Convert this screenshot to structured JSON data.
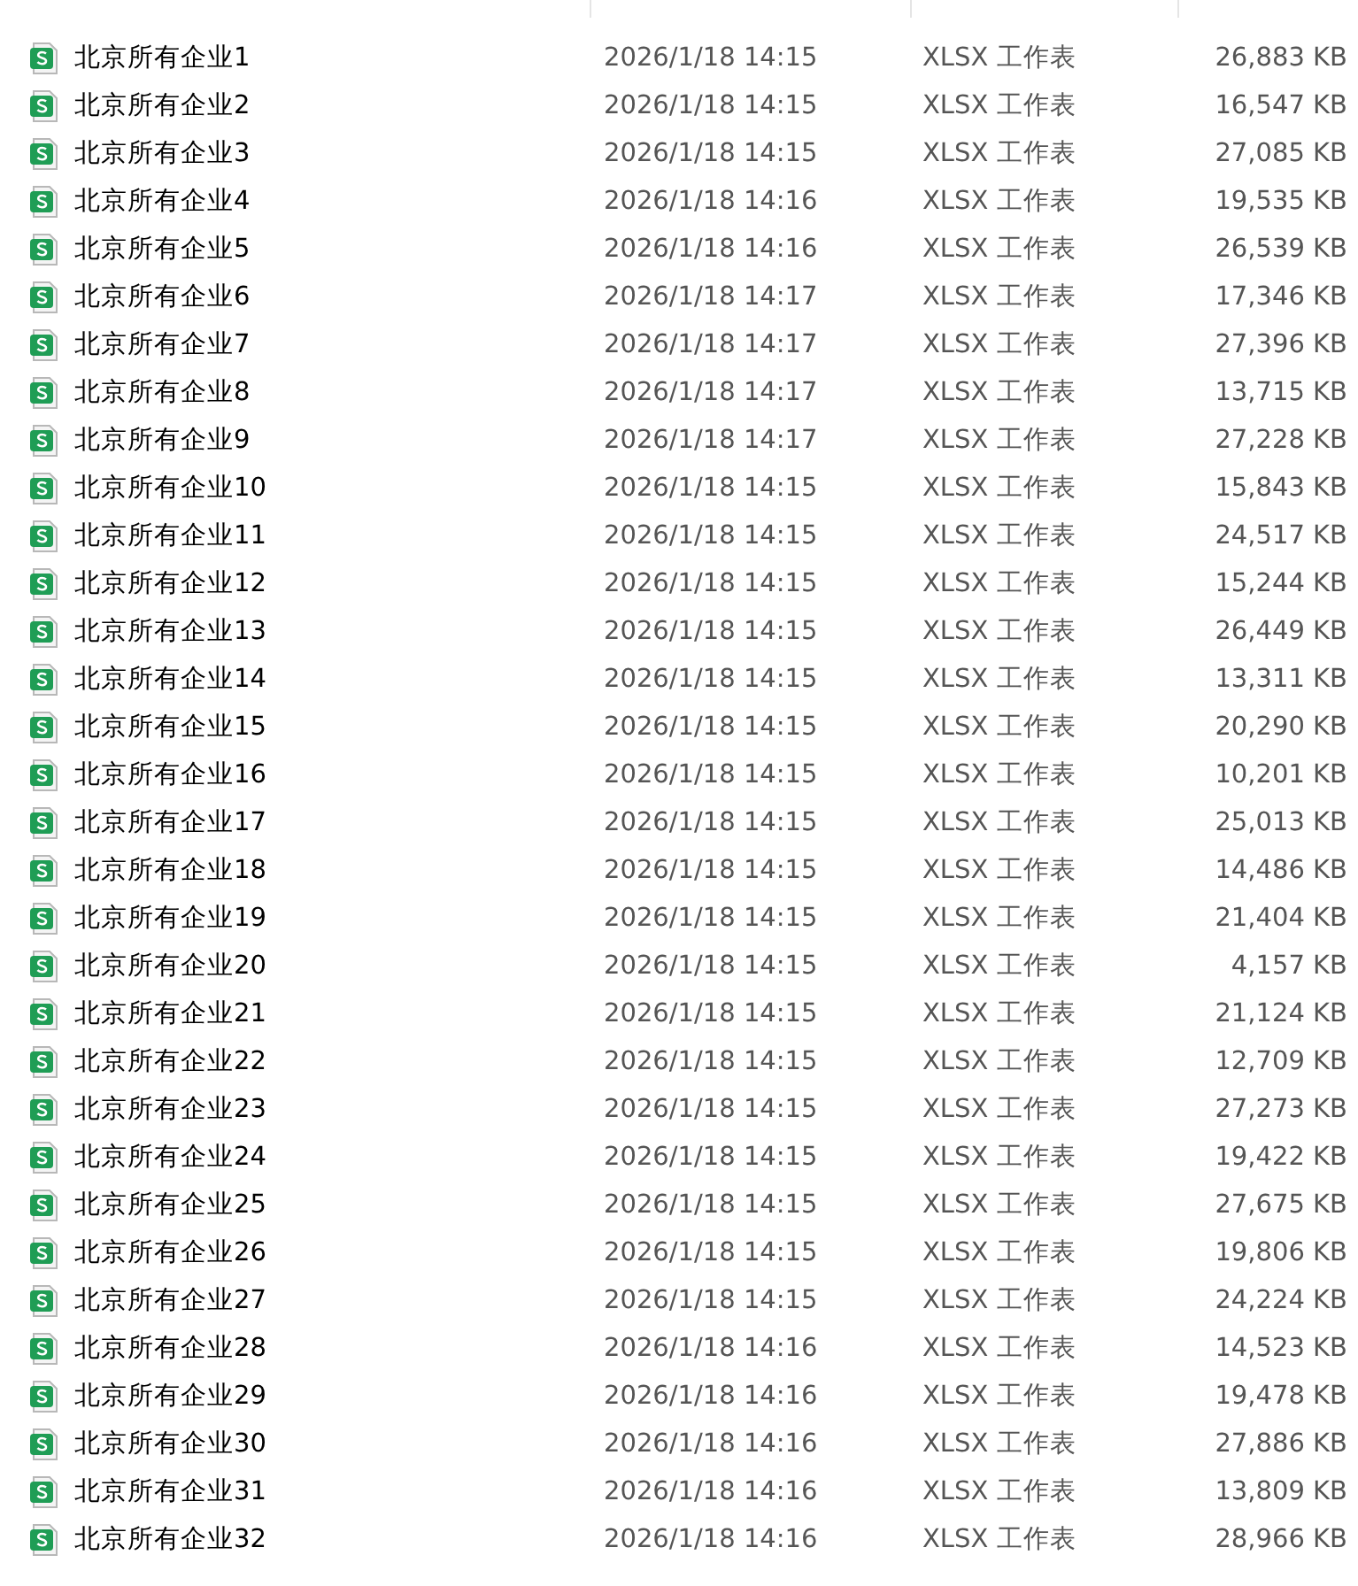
{
  "files": [
    {
      "name": "北京所有企业1",
      "modified": "2026/1/18 14:15",
      "type": "XLSX 工作表",
      "size": "26,883 KB"
    },
    {
      "name": "北京所有企业2",
      "modified": "2026/1/18 14:15",
      "type": "XLSX 工作表",
      "size": "16,547 KB"
    },
    {
      "name": "北京所有企业3",
      "modified": "2026/1/18 14:15",
      "type": "XLSX 工作表",
      "size": "27,085 KB"
    },
    {
      "name": "北京所有企业4",
      "modified": "2026/1/18 14:16",
      "type": "XLSX 工作表",
      "size": "19,535 KB"
    },
    {
      "name": "北京所有企业5",
      "modified": "2026/1/18 14:16",
      "type": "XLSX 工作表",
      "size": "26,539 KB"
    },
    {
      "name": "北京所有企业6",
      "modified": "2026/1/18 14:17",
      "type": "XLSX 工作表",
      "size": "17,346 KB"
    },
    {
      "name": "北京所有企业7",
      "modified": "2026/1/18 14:17",
      "type": "XLSX 工作表",
      "size": "27,396 KB"
    },
    {
      "name": "北京所有企业8",
      "modified": "2026/1/18 14:17",
      "type": "XLSX 工作表",
      "size": "13,715 KB"
    },
    {
      "name": "北京所有企业9",
      "modified": "2026/1/18 14:17",
      "type": "XLSX 工作表",
      "size": "27,228 KB"
    },
    {
      "name": "北京所有企业10",
      "modified": "2026/1/18 14:15",
      "type": "XLSX 工作表",
      "size": "15,843 KB"
    },
    {
      "name": "北京所有企业11",
      "modified": "2026/1/18 14:15",
      "type": "XLSX 工作表",
      "size": "24,517 KB"
    },
    {
      "name": "北京所有企业12",
      "modified": "2026/1/18 14:15",
      "type": "XLSX 工作表",
      "size": "15,244 KB"
    },
    {
      "name": "北京所有企业13",
      "modified": "2026/1/18 14:15",
      "type": "XLSX 工作表",
      "size": "26,449 KB"
    },
    {
      "name": "北京所有企业14",
      "modified": "2026/1/18 14:15",
      "type": "XLSX 工作表",
      "size": "13,311 KB"
    },
    {
      "name": "北京所有企业15",
      "modified": "2026/1/18 14:15",
      "type": "XLSX 工作表",
      "size": "20,290 KB"
    },
    {
      "name": "北京所有企业16",
      "modified": "2026/1/18 14:15",
      "type": "XLSX 工作表",
      "size": "10,201 KB"
    },
    {
      "name": "北京所有企业17",
      "modified": "2026/1/18 14:15",
      "type": "XLSX 工作表",
      "size": "25,013 KB"
    },
    {
      "name": "北京所有企业18",
      "modified": "2026/1/18 14:15",
      "type": "XLSX 工作表",
      "size": "14,486 KB"
    },
    {
      "name": "北京所有企业19",
      "modified": "2026/1/18 14:15",
      "type": "XLSX 工作表",
      "size": "21,404 KB"
    },
    {
      "name": "北京所有企业20",
      "modified": "2026/1/18 14:15",
      "type": "XLSX 工作表",
      "size": "4,157 KB"
    },
    {
      "name": "北京所有企业21",
      "modified": "2026/1/18 14:15",
      "type": "XLSX 工作表",
      "size": "21,124 KB"
    },
    {
      "name": "北京所有企业22",
      "modified": "2026/1/18 14:15",
      "type": "XLSX 工作表",
      "size": "12,709 KB"
    },
    {
      "name": "北京所有企业23",
      "modified": "2026/1/18 14:15",
      "type": "XLSX 工作表",
      "size": "27,273 KB"
    },
    {
      "name": "北京所有企业24",
      "modified": "2026/1/18 14:15",
      "type": "XLSX 工作表",
      "size": "19,422 KB"
    },
    {
      "name": "北京所有企业25",
      "modified": "2026/1/18 14:15",
      "type": "XLSX 工作表",
      "size": "27,675 KB"
    },
    {
      "name": "北京所有企业26",
      "modified": "2026/1/18 14:15",
      "type": "XLSX 工作表",
      "size": "19,806 KB"
    },
    {
      "name": "北京所有企业27",
      "modified": "2026/1/18 14:15",
      "type": "XLSX 工作表",
      "size": "24,224 KB"
    },
    {
      "name": "北京所有企业28",
      "modified": "2026/1/18 14:16",
      "type": "XLSX 工作表",
      "size": "14,523 KB"
    },
    {
      "name": "北京所有企业29",
      "modified": "2026/1/18 14:16",
      "type": "XLSX 工作表",
      "size": "19,478 KB"
    },
    {
      "name": "北京所有企业30",
      "modified": "2026/1/18 14:16",
      "type": "XLSX 工作表",
      "size": "27,886 KB"
    },
    {
      "name": "北京所有企业31",
      "modified": "2026/1/18 14:16",
      "type": "XLSX 工作表",
      "size": "13,809 KB"
    },
    {
      "name": "北京所有企业32",
      "modified": "2026/1/18 14:16",
      "type": "XLSX 工作表",
      "size": "28,966 KB"
    }
  ]
}
